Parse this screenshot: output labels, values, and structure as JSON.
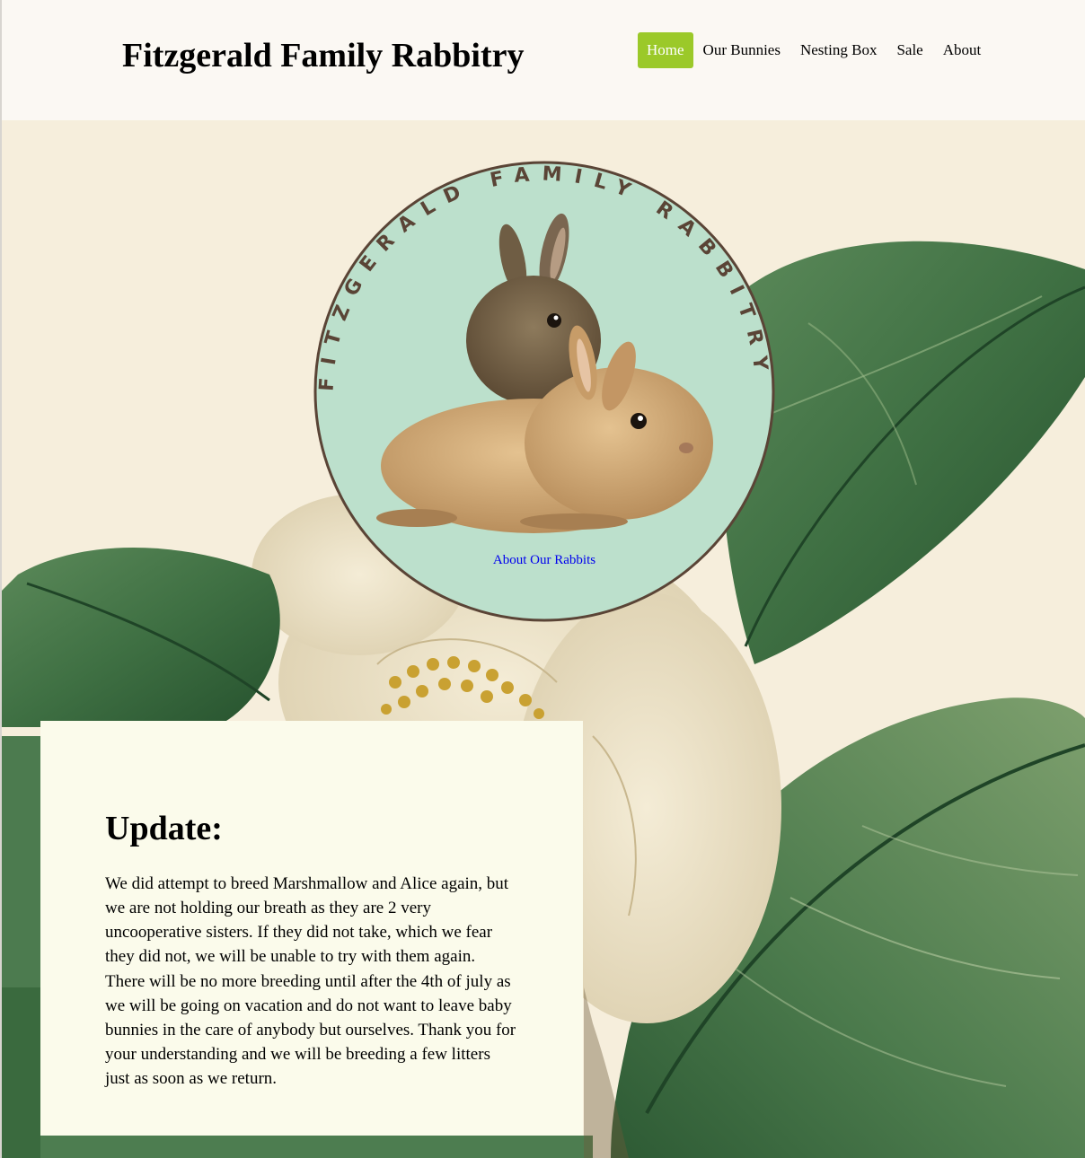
{
  "header": {
    "site_title": "Fitzgerald Family Rabbitry"
  },
  "nav": {
    "items": [
      {
        "label": "Home",
        "active": true
      },
      {
        "label": "Our Bunnies",
        "active": false
      },
      {
        "label": "Nesting Box",
        "active": false
      },
      {
        "label": "Sale",
        "active": false
      },
      {
        "label": "About",
        "active": false
      }
    ]
  },
  "logo": {
    "ring_text": "FITZGERALD FAMILY RABBITRY",
    "link_label": "About Our Rabbits"
  },
  "update": {
    "heading": "Update:",
    "body": "We did attempt to breed Marshmallow and Alice again, but we are not holding our breath as they are 2 very uncooperative sisters. If they did not take, which we fear they did not, we will be unable to try with them again. There will be no more breeding until after the 4th of july as we will be going on vacation and do not want to leave baby bunnies in the care of anybody but ourselves. Thank you for your understanding and we will be breeding a few litters just as soon as we return."
  },
  "colors": {
    "nav_active": "#9bc929",
    "logo_fill": "#bce0cc",
    "logo_ring": "#5a4436",
    "panel_bg": "#fbfbeb",
    "leaf_green": "#3d6b42",
    "flower": "#ece2c6"
  }
}
